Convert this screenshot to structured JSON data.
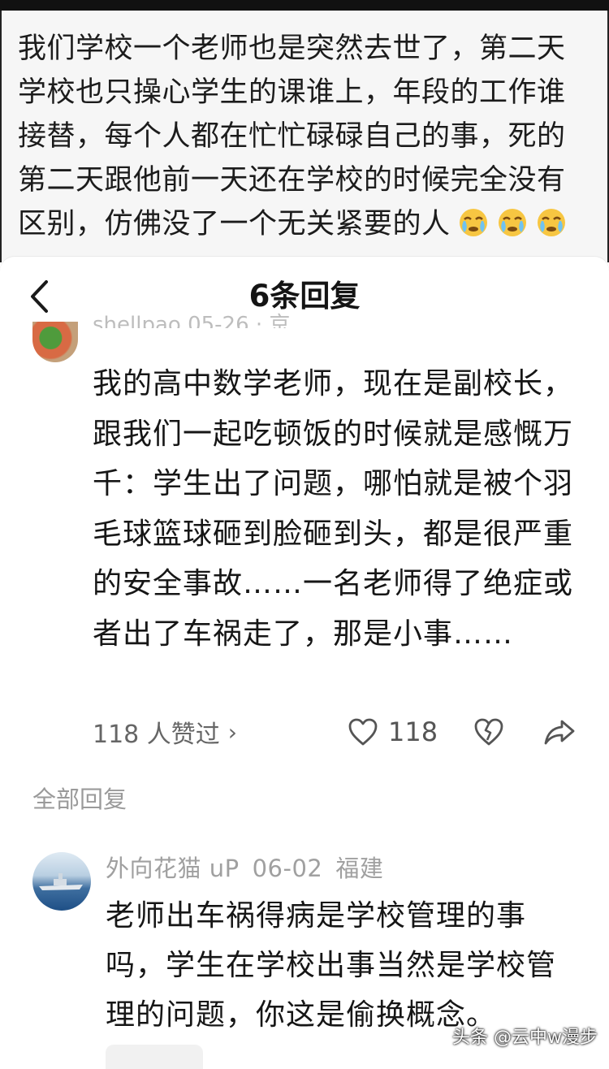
{
  "post": {
    "text": "我们学校一个老师也是突然去世了，第二天学校也只操心学生的课谁上，年段的工作谁接替，每个人都在忙忙碌碌自己的事，死的第二天跟他前一天还在学校的时候完全没有区别，仿佛没了一个无关紧要的人",
    "emojis": [
      "crying-face-emoji",
      "crying-face-emoji",
      "crying-face-emoji"
    ]
  },
  "sheet": {
    "title": "6条回复",
    "back_icon": "chevron-left-icon"
  },
  "main_comment": {
    "partial_meta": "shellpao  05-26 · 京",
    "text": "我的高中数学老师，现在是副校长，跟我们一起吃顿饭的时候就是感慨万千：学生出了问题，哪怕就是被个羽毛球篮球砸到脸砸到头，都是很严重的安全事故……一名老师得了绝症或者出了车祸走了，那是小事……",
    "liked_by": "118 人赞过",
    "like_count": "118"
  },
  "all_replies_label": "全部回复",
  "reply": {
    "username": "外向花猫 uP",
    "date": "06-02",
    "location": "福建",
    "text": "老师出车祸得病是学校管理的事吗，学生在学校出事当然是学校管理的问题，你这是偷换概念。"
  },
  "watermark": "头条 @云中w漫步"
}
